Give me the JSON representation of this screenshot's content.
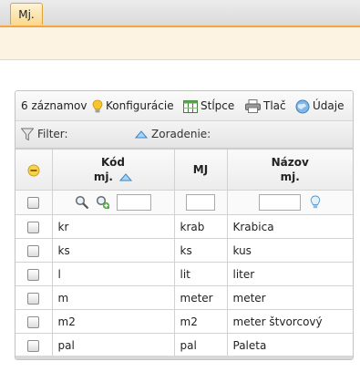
{
  "tabs": [
    {
      "label": "Mj."
    }
  ],
  "toolbar": {
    "record_count": "6 záznamov",
    "config_label": "Konfigurácie",
    "columns_label": "Stĺpce",
    "print_label": "Tlač",
    "data_label": "Údaje"
  },
  "filterbar": {
    "filter_label": "Filter:",
    "sort_label": "Zoradenie:"
  },
  "grid": {
    "columns": [
      {
        "line1": "Kód",
        "line2": "mj."
      },
      {
        "line1": "MJ",
        "line2": ""
      },
      {
        "line1": "Názov",
        "line2": "mj."
      }
    ],
    "sort_column": "Kód mj.",
    "sort_direction": "ascending",
    "rows": [
      {
        "kod": "kr",
        "mj": "krab",
        "nazov": "Krabica"
      },
      {
        "kod": "ks",
        "mj": "ks",
        "nazov": "kus"
      },
      {
        "kod": "l",
        "mj": "lit",
        "nazov": "liter"
      },
      {
        "kod": "m",
        "mj": "meter",
        "nazov": "meter"
      },
      {
        "kod": "m2",
        "mj": "m2",
        "nazov": "meter štvorcový"
      },
      {
        "kod": "pal",
        "mj": "pal",
        "nazov": "Paleta"
      }
    ]
  },
  "icons": {
    "config": "config-bulb-icon",
    "columns": "columns-icon",
    "print": "printer-icon",
    "data": "data-globe-icon",
    "filter": "funnel-icon",
    "sort": "sort-ascending-icon",
    "select_all": "select-toggle-icon",
    "search": "search-icon",
    "search_add": "search-add-icon",
    "hint": "hint-bulb-icon"
  },
  "colors": {
    "accent": "#f6a43c",
    "tab_fill": "#f9d98f"
  }
}
